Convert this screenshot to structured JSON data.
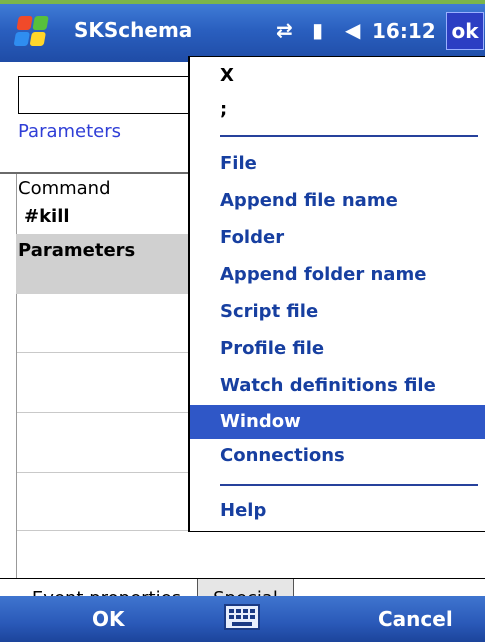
{
  "title_bar": {
    "app_title": "SKSchema",
    "time": "16:12",
    "ok_label": "ok",
    "icons": [
      "windows-start-icon",
      "connectivity-icon",
      "signal-icon",
      "volume-icon"
    ]
  },
  "content": {
    "parameters_link": "Parameters",
    "command_label": "Command",
    "command_value": "#kill",
    "parameters_label": "Parameters"
  },
  "tabs": [
    {
      "label": "Event properties"
    },
    {
      "label": "Special"
    }
  ],
  "softkeys": {
    "left": "OK",
    "right": "Cancel",
    "icon": "keyboard-icon"
  },
  "menu": {
    "items": [
      {
        "label": "X"
      },
      {
        "label": ";"
      },
      {
        "label": "File"
      },
      {
        "label": "Append file name"
      },
      {
        "label": "Folder"
      },
      {
        "label": "Append folder name"
      },
      {
        "label": "Script file"
      },
      {
        "label": "Profile file"
      },
      {
        "label": "Watch definitions file"
      },
      {
        "label": "Window"
      },
      {
        "label": "Connections"
      },
      {
        "label": "Help"
      }
    ],
    "highlighted": "Window"
  },
  "colors": {
    "title_bar": "#2a5fbf",
    "menu_text": "#173fa0",
    "menu_highlight": "#2f57c7",
    "softkey_bar": "#2a59b8"
  }
}
